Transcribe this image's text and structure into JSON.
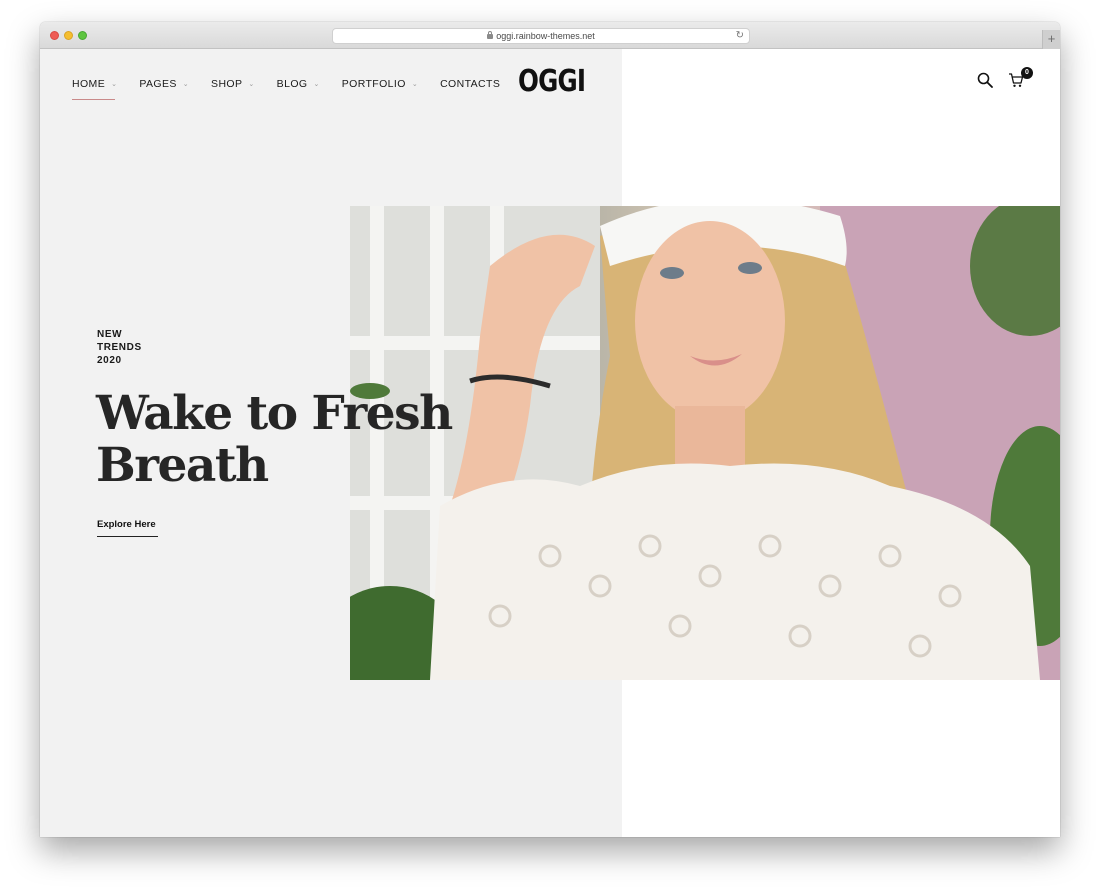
{
  "browser": {
    "url": "oggi.rainbow-themes.net",
    "new_tab": "+"
  },
  "nav": {
    "items": [
      {
        "label": "HOME",
        "has_dropdown": true,
        "active": true
      },
      {
        "label": "PAGES",
        "has_dropdown": true
      },
      {
        "label": "SHOP",
        "has_dropdown": true
      },
      {
        "label": "BLOG",
        "has_dropdown": true
      },
      {
        "label": "PORTFOLIO",
        "has_dropdown": true
      },
      {
        "label": "CONTACTS",
        "has_dropdown": false
      }
    ],
    "chevron": "⌄"
  },
  "logo": "OGGI",
  "cart": {
    "count": "0"
  },
  "hero": {
    "eyebrow": "NEW\nTRENDS\n2020",
    "headline": "Wake to Fresh\nBreath",
    "cta": "Explore Here"
  },
  "colors": {
    "left_panel": "#f2f2f2",
    "accent_underline": "#c98a8a",
    "text": "#1a1a1a"
  }
}
